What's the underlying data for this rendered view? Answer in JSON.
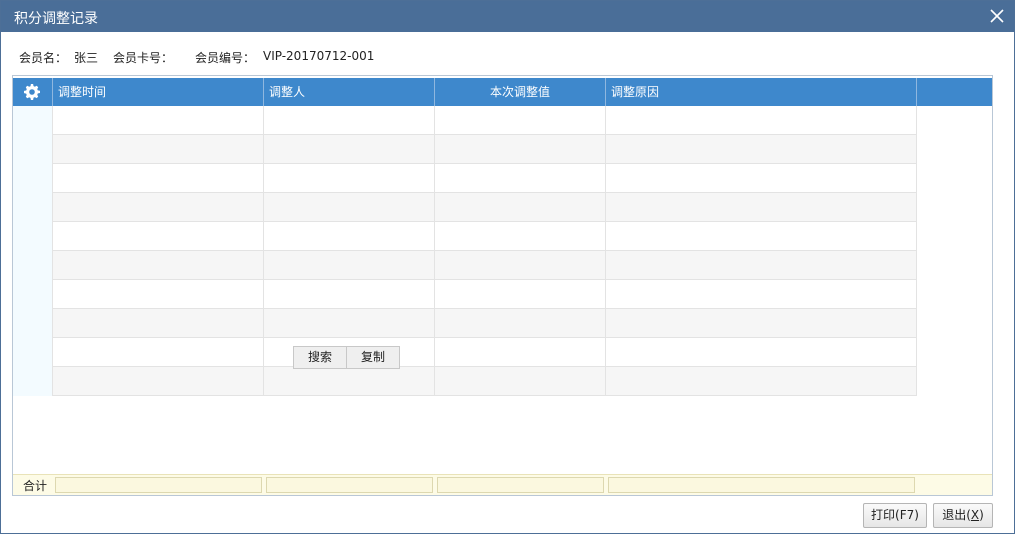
{
  "window": {
    "title": "积分调整记录"
  },
  "member": {
    "name_label": "会员名：",
    "name_value": "张三",
    "card_label": "会员卡号：",
    "card_value": "",
    "code_label": "会员编号：",
    "code_value": "VIP-20170712-001"
  },
  "grid": {
    "columns": [
      "调整时间",
      "调整人",
      "本次调整值",
      "调整原因"
    ],
    "row_count": 10,
    "rows": []
  },
  "context_menu": {
    "items": [
      "搜索",
      "复制"
    ]
  },
  "footer": {
    "sum_label": "合计"
  },
  "buttons": {
    "print_prefix": "打印(F7)",
    "exit_prefix": "退出(",
    "exit_key": "X",
    "exit_suffix": ")"
  },
  "icons": {
    "close": "close-icon",
    "settings": "gear-icon"
  },
  "colors": {
    "titlebar": "#4a6e98",
    "header": "#3e88cc",
    "footer": "#fdfbe6"
  }
}
